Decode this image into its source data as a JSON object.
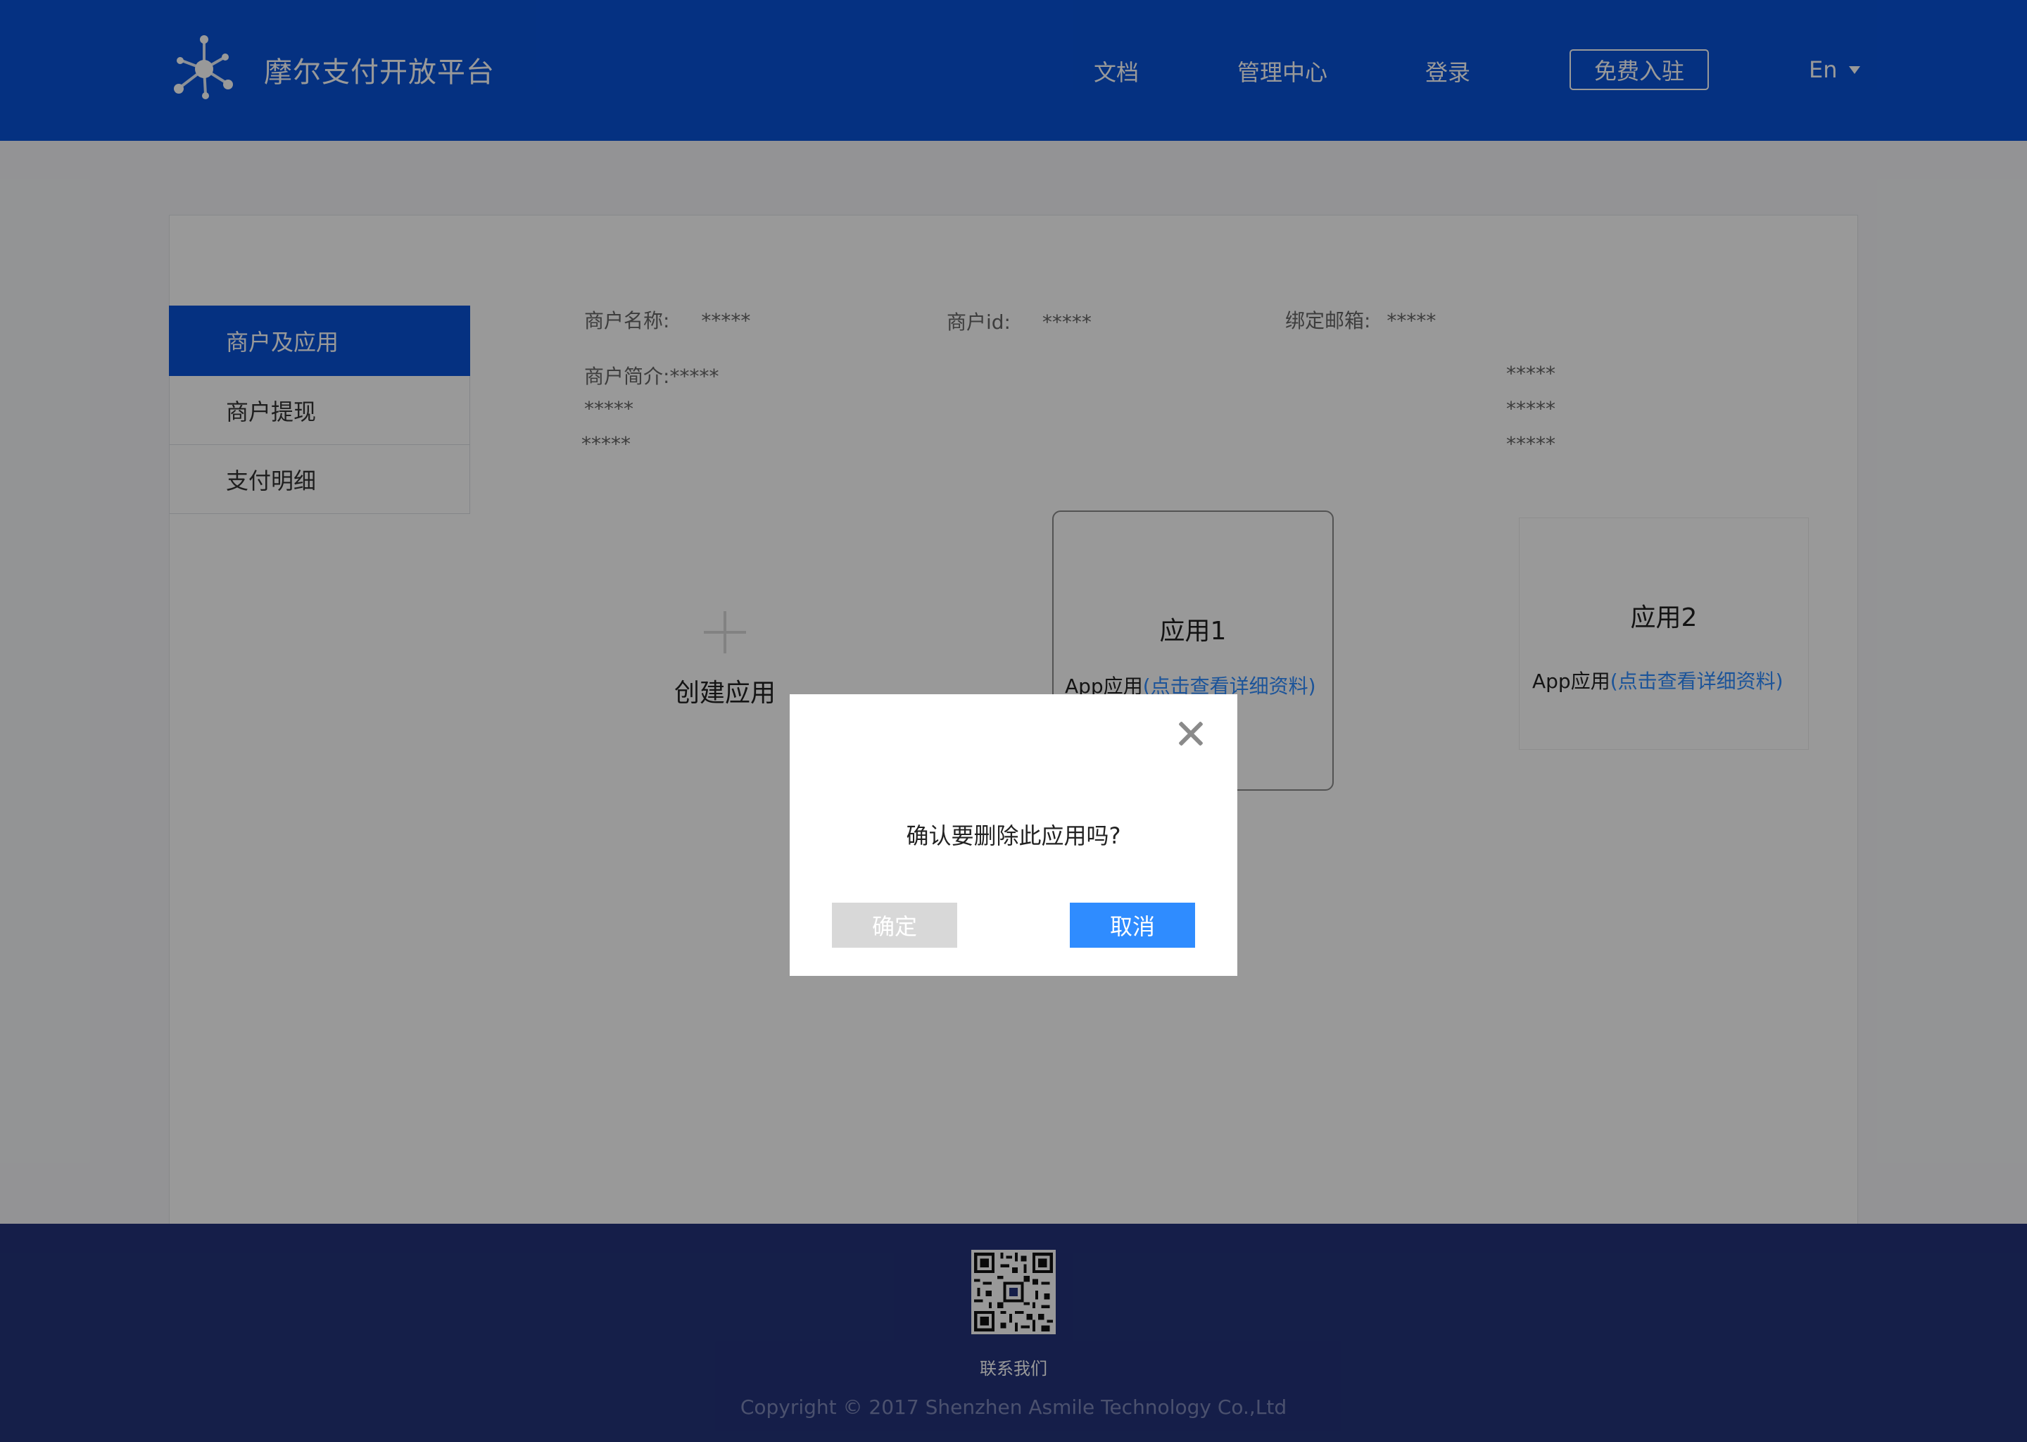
{
  "header": {
    "brand": "摩尔支付开放平台",
    "nav": {
      "docs": "文档",
      "manage": "管理中心",
      "login": "登录",
      "register": "免费入驻",
      "language": "En"
    }
  },
  "sidebar": {
    "items": [
      {
        "label": "商户及应用",
        "active": true
      },
      {
        "label": "商户提现",
        "active": false
      },
      {
        "label": "支付明细",
        "active": false
      }
    ]
  },
  "merchant": {
    "name_label": "商户名称:",
    "name_value": "*****",
    "id_label": "商户id:",
    "id_value": "*****",
    "email_label": "绑定邮箱:",
    "email_value": "*****",
    "intro_label": "商户简介:",
    "intro_lines": [
      "*****",
      "*****",
      "*****"
    ],
    "right_lines": [
      "*****",
      "*****",
      "*****"
    ]
  },
  "apps": {
    "create_label": "创建应用",
    "items": [
      {
        "title": "应用1",
        "desc": "App应用",
        "link": "(点击查看详细资料)"
      },
      {
        "title": "应用2",
        "desc": "App应用",
        "link": "(点击查看详细资料)"
      }
    ]
  },
  "dialog": {
    "message": "确认要删除此应用吗?",
    "confirm": "确定",
    "cancel": "取消"
  },
  "footer": {
    "contact": "联系我们",
    "copyright": "Copyright © 2017 Shenzhen Asmile Technology Co.,Ltd"
  },
  "colors": {
    "header_bg": "#0952d8",
    "footer_bg": "#23337a",
    "primary_button": "#2f8cff",
    "link": "#2f8cff"
  },
  "icons": {
    "logo": "molecule-logo-icon",
    "close": "close-icon",
    "create": "plus-icon",
    "language_caret": "caret-down-icon",
    "qr": "qr-code-icon"
  }
}
